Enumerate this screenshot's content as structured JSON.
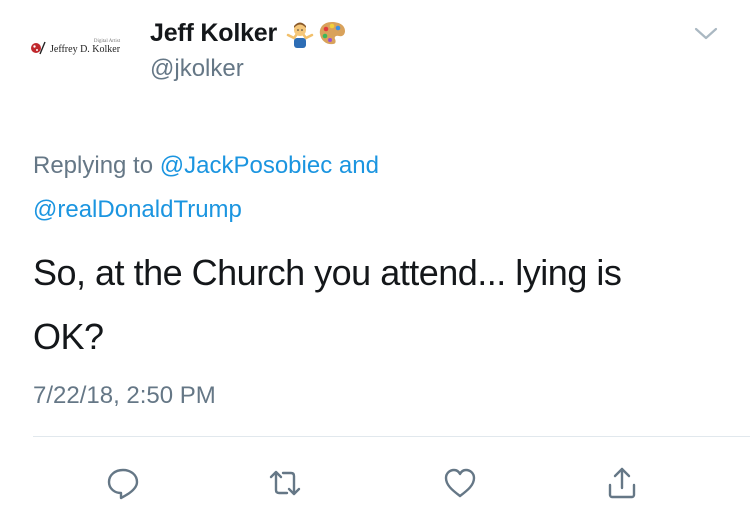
{
  "author": {
    "display_name": "Jeff Kolker",
    "handle": "@jkolker",
    "avatar": {
      "subtitle": "Digital Artist",
      "name": "Jeffrey D. Kolker"
    },
    "emojis": [
      "person-shrugging-emoji",
      "artist-palette-emoji"
    ]
  },
  "reply": {
    "prefix": "Replying to",
    "mention_1": "@JackPosobiec",
    "conjunction": "and",
    "mention_2": "@realDonaldTrump"
  },
  "tweet": {
    "text_line_1": "So, at the Church you attend... lying is",
    "text_line_2": "OK?",
    "timestamp": "7/22/18, 2:50 PM"
  },
  "actions": {
    "icons": [
      "reply-icon",
      "retweet-icon",
      "like-icon",
      "share-icon"
    ]
  },
  "colors": {
    "link": "#1b95e0",
    "secondary_text": "#657786",
    "primary_text": "#14171a",
    "icon": "#657786",
    "divider": "#e1e8ed"
  }
}
